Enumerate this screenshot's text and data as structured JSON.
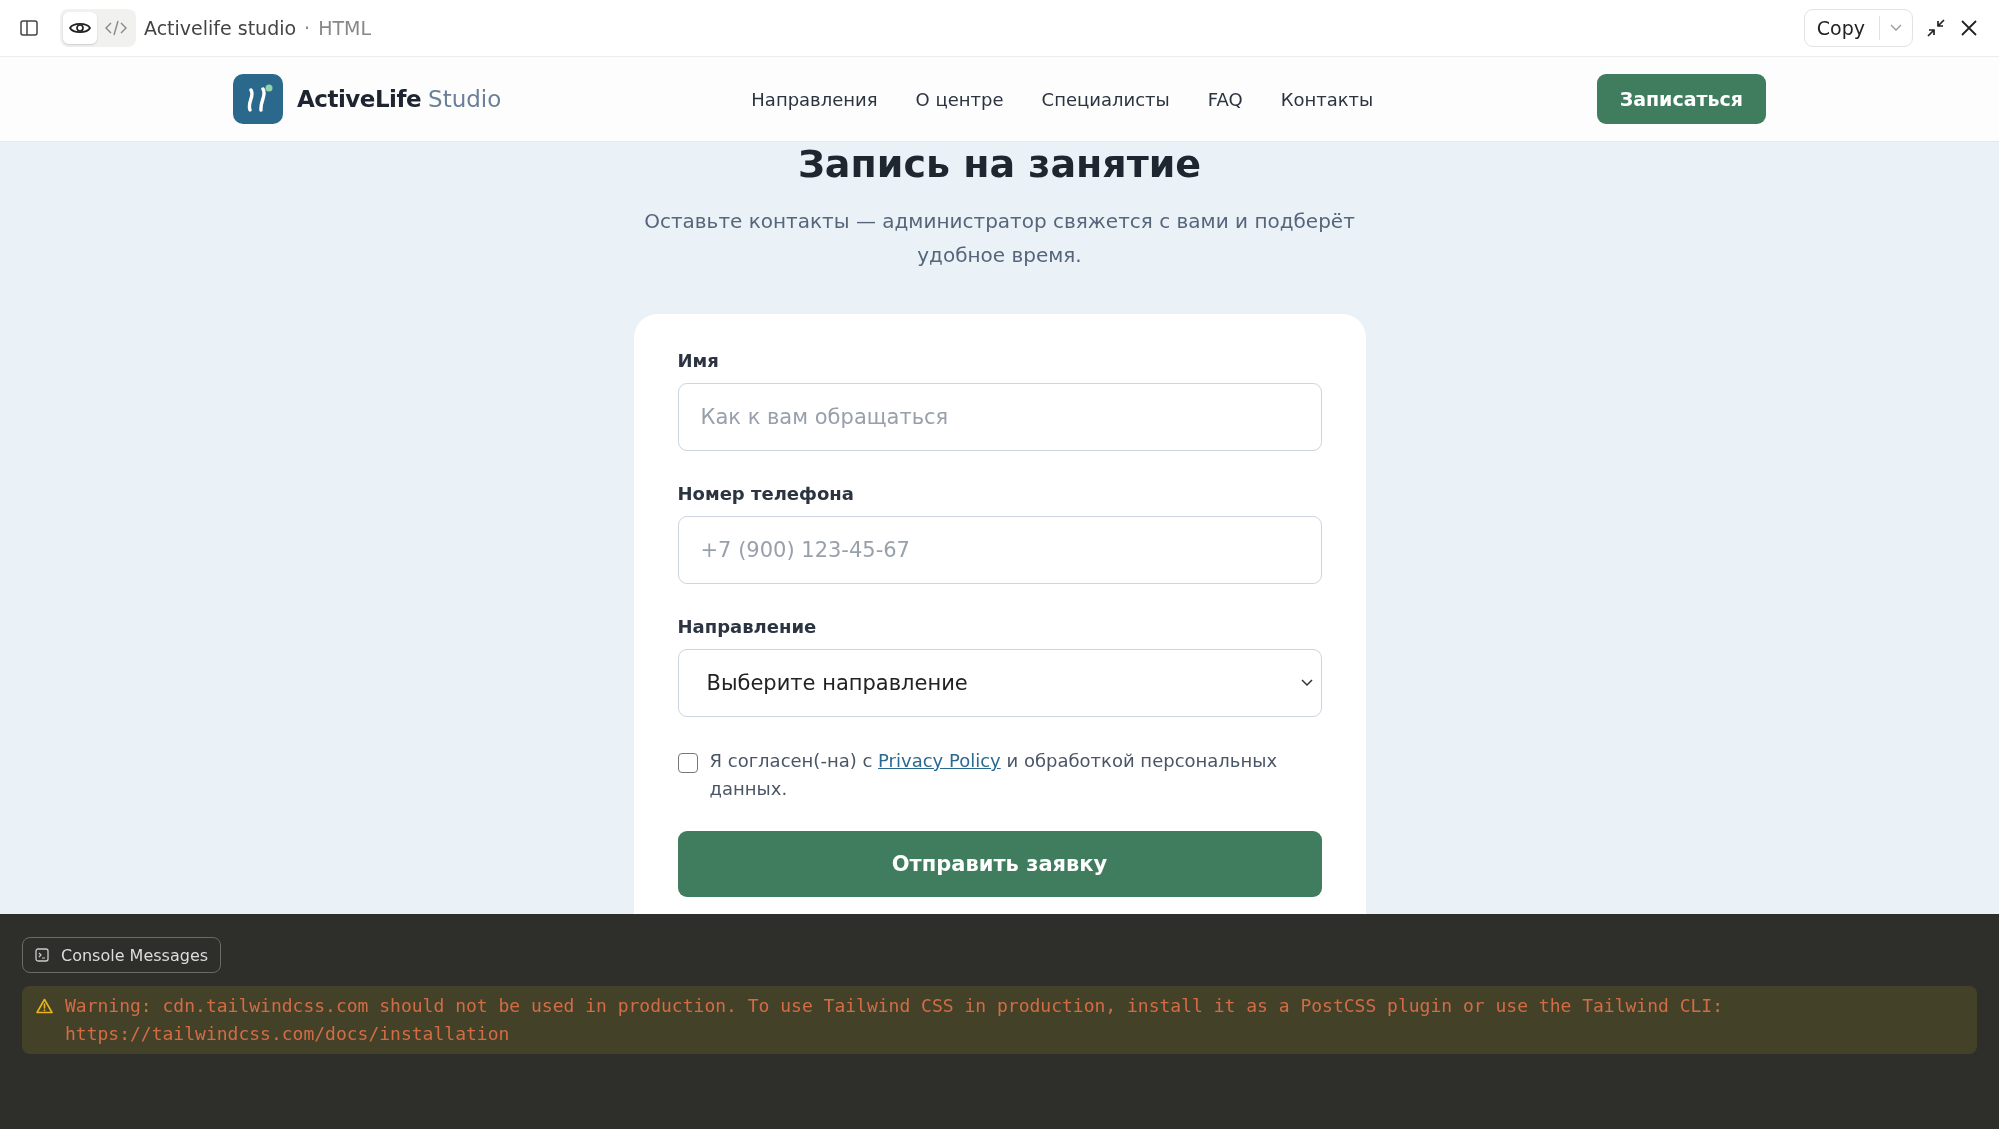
{
  "toolbar": {
    "views": [
      {
        "kind": "preview",
        "selected": true
      },
      {
        "kind": "code",
        "selected": false
      }
    ],
    "title": "Activelife studio",
    "separator": "·",
    "subtitle": "HTML",
    "copy": "Copy"
  },
  "site_header": {
    "brand": "ActiveLife",
    "brand_suffix": "Studio",
    "nav": [
      "Направления",
      "О центре",
      "Специалисты",
      "FAQ",
      "Контакты"
    ],
    "cta": "Записаться"
  },
  "hero": {
    "title": "Запись на занятие",
    "subtitle": "Оставьте контакты — администратор свяжется с вами и подберёт удобное время."
  },
  "form": {
    "fields": [
      {
        "kind": "text",
        "label": "Имя",
        "placeholder": "Как к вам обращаться"
      },
      {
        "kind": "text",
        "label": "Номер телефона",
        "placeholder": "+7 (900) 123-45-67"
      },
      {
        "kind": "select",
        "label": "Направление",
        "value": "Выберите направление"
      }
    ],
    "consent": {
      "checked": false,
      "before": "Я согласен(-на) с",
      "link": "Privacy Policy",
      "after": "и обработкой персональных данных."
    },
    "submit": "Отправить заявку"
  },
  "console": {
    "button": "Console Messages",
    "messages": [
      {
        "kind": "warning",
        "text": "Warning: cdn.tailwindcss.com should not be used in production. To use Tailwind CSS in production, install it as a PostCSS plugin or use the Tailwind CLI: https://tailwindcss.com/docs/installation"
      }
    ]
  }
}
